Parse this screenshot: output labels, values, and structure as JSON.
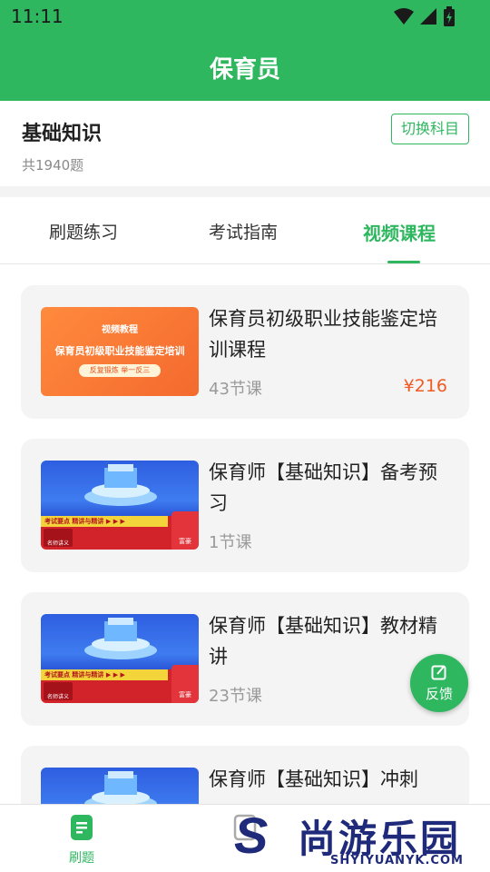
{
  "status": {
    "time": "11:11"
  },
  "header": {
    "title": "保育员"
  },
  "subject": {
    "name": "基础知识",
    "count": "共1940题",
    "switch_label": "切换科目"
  },
  "tabs": [
    {
      "label": "刷题练习",
      "active": false
    },
    {
      "label": "考试指南",
      "active": false
    },
    {
      "label": "视频课程",
      "active": true
    }
  ],
  "courses": [
    {
      "title": "保育员初级职业技能鉴定培训课程",
      "lessons": "43节课",
      "price": "¥216",
      "thumb": {
        "type": "orange",
        "line1": "视频教程",
        "line2": "保育员初级职业技能鉴定培训",
        "pill": "反复锻炼 举一反三"
      }
    },
    {
      "title": "保育师【基础知识】备考预习",
      "lessons": "1节课",
      "price": "",
      "thumb": {
        "type": "blue",
        "ribbon": "考试要点  精讲与精讲 ▶ ▶ ▶",
        "chip": "名师讲义",
        "teacher": "富豪"
      }
    },
    {
      "title": "保育师【基础知识】教材精讲",
      "lessons": "23节课",
      "price": "",
      "thumb": {
        "type": "blue",
        "ribbon": "考试要点  精讲与精讲 ▶ ▶ ▶",
        "chip": "名师讲义",
        "teacher": "富豪"
      }
    },
    {
      "title": "保育师【基础知识】冲刺",
      "lessons": "",
      "price": "",
      "thumb": {
        "type": "blue",
        "ribbon": "",
        "chip": "",
        "teacher": ""
      }
    }
  ],
  "fab": {
    "label": "反馈",
    "icon": "edit-icon"
  },
  "bottom_nav": [
    {
      "label": "刷题",
      "icon": "document-icon",
      "active": true
    },
    {
      "label": "",
      "icon": "book-icon",
      "active": false
    }
  ],
  "watermark": {
    "letter": "S",
    "cn": "尚游乐园",
    "en": "SHYIYUANYK.COM"
  },
  "colors": {
    "primary": "#2fb760",
    "price": "#f05a23",
    "watermark": "#1f2a7a"
  }
}
